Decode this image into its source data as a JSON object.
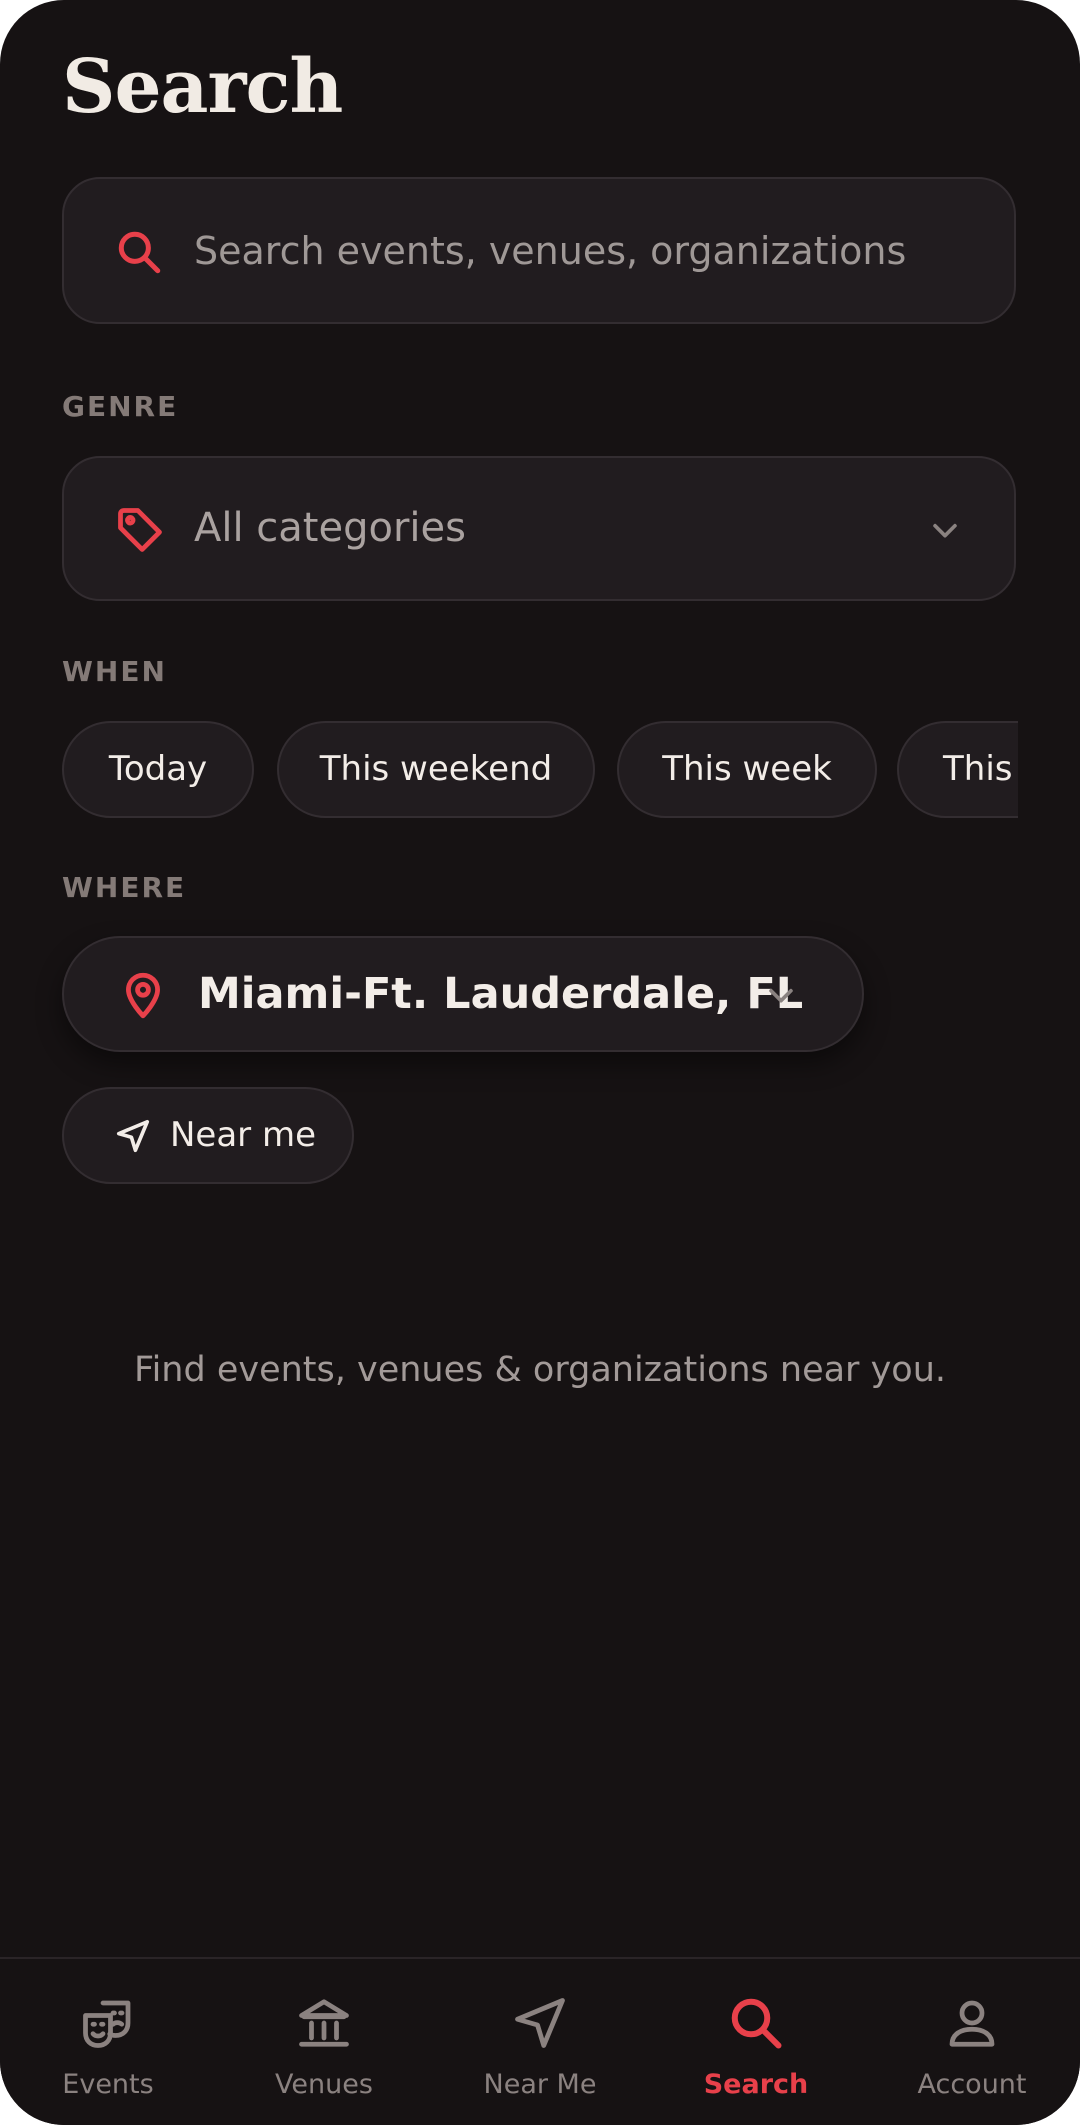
{
  "page": {
    "title": "Search"
  },
  "search": {
    "placeholder": "Search events, venues, organizations"
  },
  "genre": {
    "label": "GENRE",
    "selected": "All categories"
  },
  "when": {
    "label": "WHEN",
    "chips": [
      "Today",
      "This weekend",
      "This week",
      "This"
    ]
  },
  "where": {
    "label": "WHERE",
    "location": "Miami-Ft. Lauderdale, FL",
    "near_me": "Near me"
  },
  "empty_state": {
    "message": "Find events, venues & organizations near you."
  },
  "bottom_nav": {
    "items": [
      {
        "label": "Events",
        "icon": "theater-masks-icon"
      },
      {
        "label": "Venues",
        "icon": "museum-icon"
      },
      {
        "label": "Near Me",
        "icon": "navigation-arrow-icon"
      },
      {
        "label": "Search",
        "icon": "search-icon",
        "active": true
      },
      {
        "label": "Account",
        "icon": "user-icon"
      }
    ]
  },
  "colors": {
    "background": "#161213",
    "surface": "#211c1f",
    "accent": "#e8404a",
    "text": "#f3ede8",
    "muted": "#847a77"
  }
}
